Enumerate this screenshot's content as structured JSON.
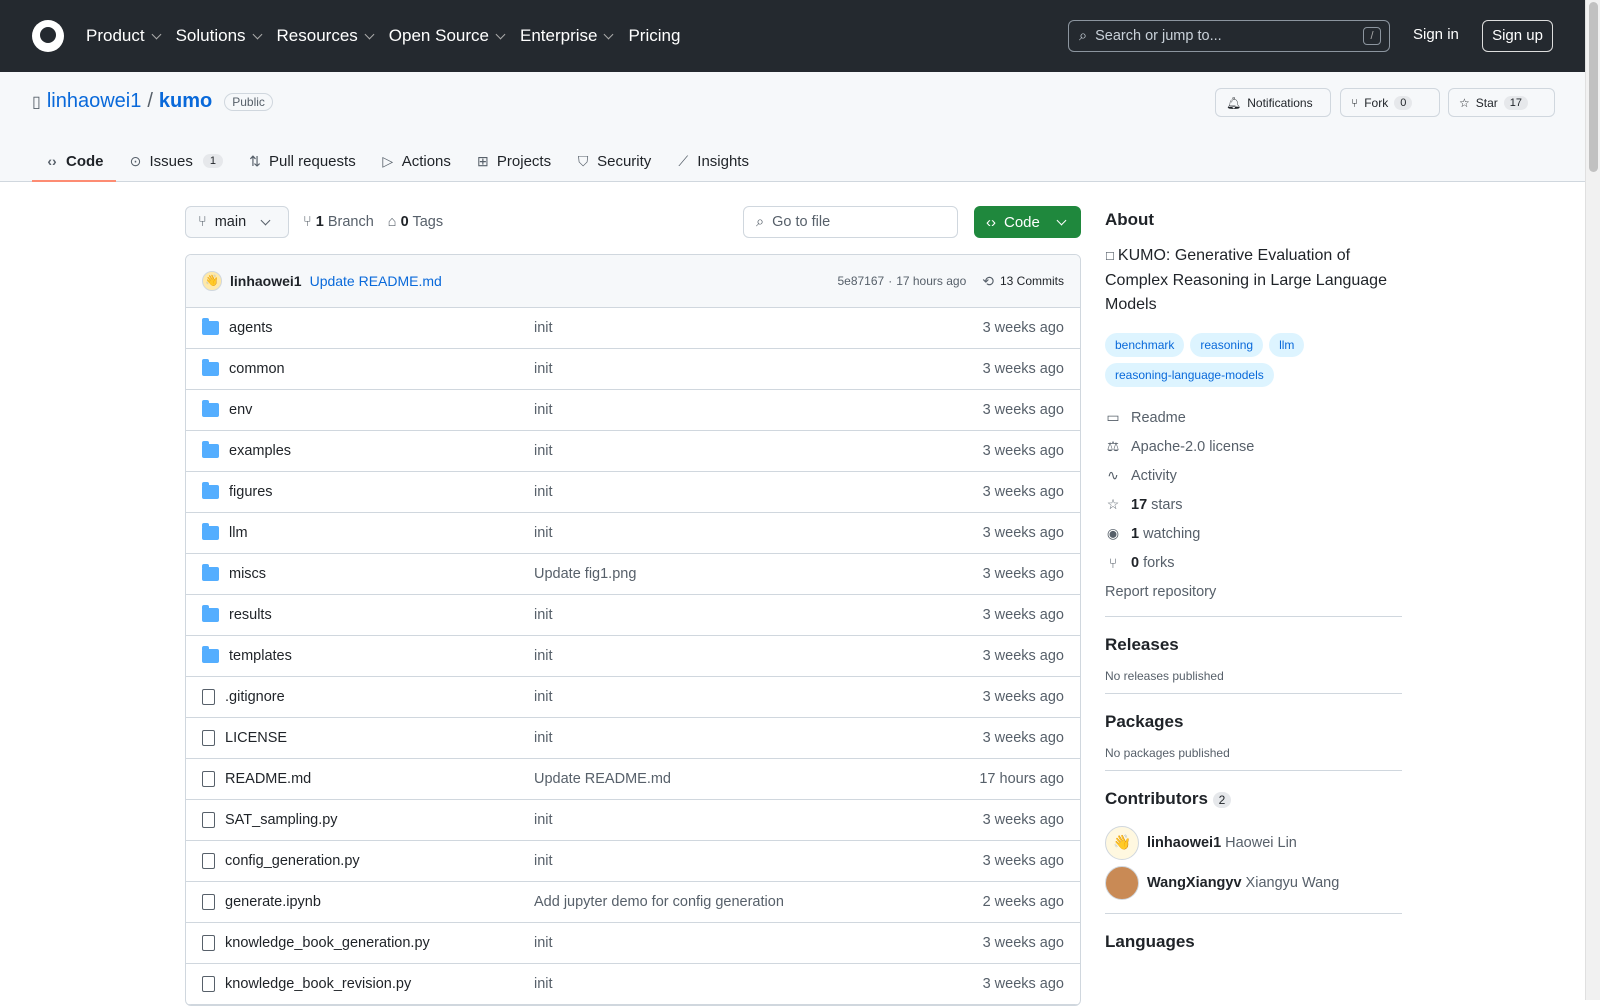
{
  "nav": {
    "items": [
      "Product",
      "Solutions",
      "Resources",
      "Open Source",
      "Enterprise",
      "Pricing"
    ],
    "search_placeholder": "Search or jump to...",
    "slash": "/",
    "signin": "Sign in",
    "signup": "Sign up"
  },
  "repo": {
    "owner": "linhaowei1",
    "sep": "/",
    "name": "kumo",
    "visibility": "Public",
    "notifications": "Notifications",
    "fork_label": "Fork",
    "fork_count": "0",
    "star_label": "Star",
    "star_count": "17"
  },
  "tabs": [
    {
      "label": "Code",
      "icon": "code-icon"
    },
    {
      "label": "Issues",
      "count": "1",
      "icon": "issue-icon"
    },
    {
      "label": "Pull requests",
      "icon": "pull-request-icon"
    },
    {
      "label": "Actions",
      "icon": "play-icon"
    },
    {
      "label": "Projects",
      "icon": "table-icon"
    },
    {
      "label": "Security",
      "icon": "shield-icon"
    },
    {
      "label": "Insights",
      "icon": "graph-icon"
    }
  ],
  "branch": {
    "name": "main",
    "branch_count": "1",
    "branch_label": "Branch",
    "tag_count": "0",
    "tag_label": "Tags",
    "gofile": "Go to file",
    "code_button": "Code"
  },
  "commit": {
    "author": "linhaowei1",
    "message": "Update README.md",
    "hash": "5e87167",
    "dot": "·",
    "time": "17 hours ago",
    "commits": "13 Commits"
  },
  "files": [
    {
      "name": "agents",
      "type": "folder",
      "msg": "init",
      "date": "3 weeks ago"
    },
    {
      "name": "common",
      "type": "folder",
      "msg": "init",
      "date": "3 weeks ago"
    },
    {
      "name": "env",
      "type": "folder",
      "msg": "init",
      "date": "3 weeks ago"
    },
    {
      "name": "examples",
      "type": "folder",
      "msg": "init",
      "date": "3 weeks ago"
    },
    {
      "name": "figures",
      "type": "folder",
      "msg": "init",
      "date": "3 weeks ago"
    },
    {
      "name": "llm",
      "type": "folder",
      "msg": "init",
      "date": "3 weeks ago"
    },
    {
      "name": "miscs",
      "type": "folder",
      "msg": "Update fig1.png",
      "date": "3 weeks ago"
    },
    {
      "name": "results",
      "type": "folder",
      "msg": "init",
      "date": "3 weeks ago"
    },
    {
      "name": "templates",
      "type": "folder",
      "msg": "init",
      "date": "3 weeks ago"
    },
    {
      "name": ".gitignore",
      "type": "file",
      "msg": "init",
      "date": "3 weeks ago"
    },
    {
      "name": "LICENSE",
      "type": "file",
      "msg": "init",
      "date": "3 weeks ago"
    },
    {
      "name": "README.md",
      "type": "file",
      "msg": "Update README.md",
      "date": "17 hours ago"
    },
    {
      "name": "SAT_sampling.py",
      "type": "file",
      "msg": "init",
      "date": "3 weeks ago"
    },
    {
      "name": "config_generation.py",
      "type": "file",
      "msg": "init",
      "date": "3 weeks ago"
    },
    {
      "name": "generate.ipynb",
      "type": "file",
      "msg": "Add jupyter demo for config generation",
      "date": "2 weeks ago"
    },
    {
      "name": "knowledge_book_generation.py",
      "type": "file",
      "msg": "init",
      "date": "3 weeks ago"
    },
    {
      "name": "knowledge_book_revision.py",
      "type": "file",
      "msg": "init",
      "date": "3 weeks ago"
    }
  ],
  "about": {
    "title": "About",
    "description": "KUMO: Generative Evaluation of Complex Reasoning in Large Language Models",
    "topics": [
      "benchmark",
      "reasoning",
      "llm",
      "reasoning-language-models"
    ],
    "links": [
      {
        "icon": "book-icon",
        "bold": "",
        "label": "Readme"
      },
      {
        "icon": "law-icon",
        "bold": "",
        "label": "Apache-2.0 license"
      },
      {
        "icon": "pulse-icon",
        "bold": "",
        "label": "Activity"
      },
      {
        "icon": "star-icon",
        "bold": "17",
        "label": "stars"
      },
      {
        "icon": "eye-icon",
        "bold": "1",
        "label": "watching"
      },
      {
        "icon": "fork-icon",
        "bold": "0",
        "label": "forks"
      }
    ],
    "report": "Report repository"
  },
  "releases": {
    "title": "Releases",
    "text": "No releases published"
  },
  "packages": {
    "title": "Packages",
    "text": "No packages published"
  },
  "contributors": {
    "title": "Contributors",
    "count": "2",
    "items": [
      {
        "login": "linhaowei1",
        "name": "Haowei Lin"
      },
      {
        "login": "WangXiangyv",
        "name": "Xiangyu Wang"
      }
    ]
  },
  "languages": {
    "title": "Languages"
  },
  "colors": {
    "topbar": "#24292f",
    "link": "#0969da",
    "green": "#1f883d",
    "folder": "#54aeff"
  }
}
